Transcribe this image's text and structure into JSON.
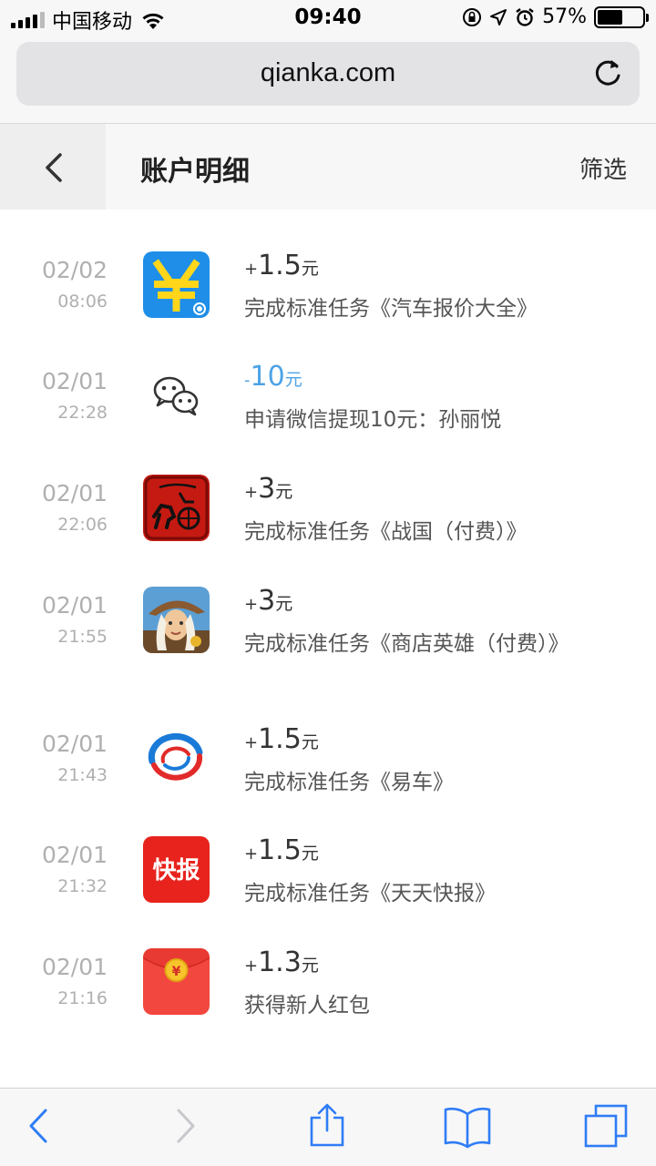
{
  "status_bar": {
    "carrier": "中国移动",
    "time": "09:40",
    "battery": "57%",
    "battery_level": 0.57
  },
  "browser": {
    "url": "qianka.com"
  },
  "header": {
    "title": "账户明细",
    "filter_label": "筛选"
  },
  "transactions": [
    {
      "date": "02/02",
      "time": "08:06",
      "sign": "+",
      "amount": "1.5",
      "unit": "元",
      "desc": "完成标准任务《汽车报价大全》",
      "icon": "yuan-app-icon",
      "negative": false
    },
    {
      "date": "02/01",
      "time": "22:28",
      "sign": "-",
      "amount": "10",
      "unit": "元",
      "desc": "申请微信提现10元：孙丽悦",
      "icon": "wechat-icon",
      "negative": true
    },
    {
      "date": "02/01",
      "time": "22:06",
      "sign": "+",
      "amount": "3",
      "unit": "元",
      "desc": "完成标准任务《战国（付费）》",
      "icon": "chariot-game-icon",
      "negative": false
    },
    {
      "date": "02/01",
      "time": "21:55",
      "sign": "+",
      "amount": "3",
      "unit": "元",
      "desc": "完成标准任务《商店英雄（付费）》",
      "icon": "hero-game-icon",
      "negative": false
    },
    {
      "date": "02/01",
      "time": "21:43",
      "sign": "+",
      "amount": "1.5",
      "unit": "元",
      "desc": "完成标准任务《易车》",
      "icon": "yiche-logo-icon",
      "negative": false
    },
    {
      "date": "02/01",
      "time": "21:32",
      "sign": "+",
      "amount": "1.5",
      "unit": "元",
      "desc": "完成标准任务《天天快报》",
      "icon": "kuaibao-icon",
      "negative": false
    },
    {
      "date": "02/01",
      "time": "21:16",
      "sign": "+",
      "amount": "1.3",
      "unit": "元",
      "desc": "获得新人红包",
      "icon": "red-envelope-icon",
      "negative": false
    }
  ],
  "icons": {
    "kuaibao_text": "快报",
    "red_envelope_coin": "¥",
    "yuan_app_glyph": "¥"
  },
  "colors": {
    "negative_amount": "#4da3e6",
    "ios_blue": "#2f7cf6"
  }
}
